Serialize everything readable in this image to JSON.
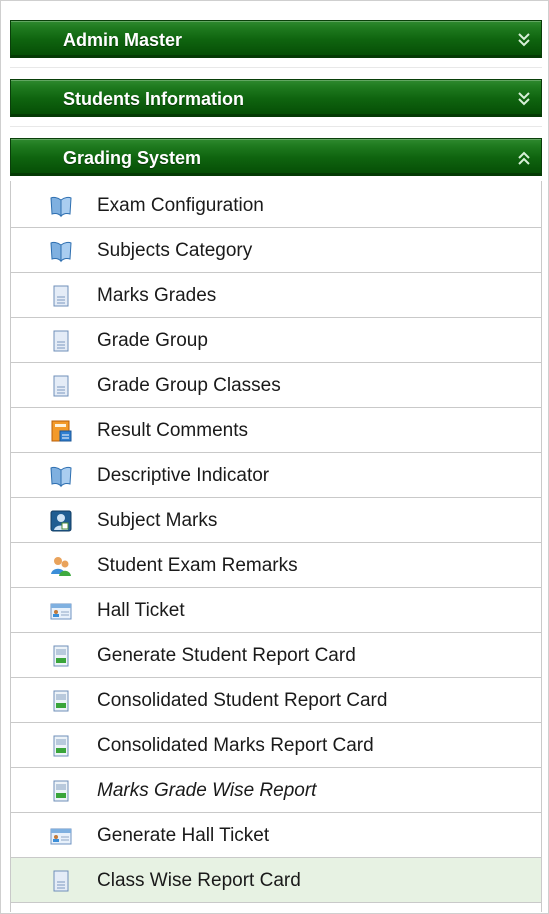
{
  "sections": [
    {
      "title": "Admin Master",
      "state": "collapsed",
      "chevron": "double-chevron-down-icon"
    },
    {
      "title": "Students Information",
      "state": "collapsed",
      "chevron": "double-chevron-down-icon"
    },
    {
      "title": "Grading System",
      "state": "expanded",
      "chevron": "double-chevron-up-icon"
    }
  ],
  "grading_items": [
    {
      "label": "Exam Configuration",
      "icon": "book-icon"
    },
    {
      "label": "Subjects Category",
      "icon": "book-icon"
    },
    {
      "label": "Marks Grades",
      "icon": "document-icon"
    },
    {
      "label": "Grade Group",
      "icon": "document-icon"
    },
    {
      "label": "Grade Group Classes",
      "icon": "document-icon"
    },
    {
      "label": "Result Comments",
      "icon": "comment-form-icon"
    },
    {
      "label": "Descriptive Indicator",
      "icon": "book-icon"
    },
    {
      "label": "Subject Marks",
      "icon": "user-marks-icon"
    },
    {
      "label": "Student Exam Remarks",
      "icon": "users-icon"
    },
    {
      "label": "Hall Ticket",
      "icon": "id-card-icon"
    },
    {
      "label": "Generate Student Report Card",
      "icon": "report-sheet-icon"
    },
    {
      "label": "Consolidated Student Report Card",
      "icon": "report-sheet-icon"
    },
    {
      "label": "Consolidated Marks Report Card",
      "icon": "report-sheet-icon"
    },
    {
      "label": "Marks Grade Wise Report",
      "icon": "report-sheet-icon",
      "italic": true
    },
    {
      "label": "Generate Hall Ticket",
      "icon": "id-card-icon"
    },
    {
      "label": "Class Wise Report Card",
      "icon": "document-icon",
      "selected": true
    }
  ],
  "colors": {
    "header_green": "#0f640f",
    "selected_row": "#e7f2e3",
    "row_border": "#c9c9c9"
  }
}
